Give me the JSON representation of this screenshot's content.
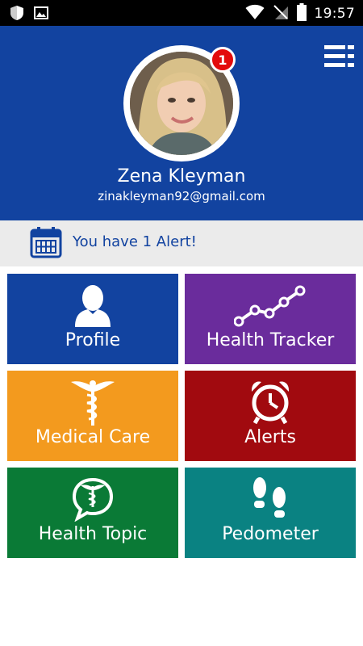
{
  "status_bar": {
    "time": "19:57",
    "icons": [
      "shield-icon",
      "image-icon",
      "wifi-icon",
      "no-sim-icon",
      "battery-icon"
    ]
  },
  "header": {
    "menu_icon": "menu-list-icon",
    "notification_count": "1",
    "user_name": "Zena Kleyman",
    "user_email": "zinakleyman92@gmail.com"
  },
  "alert": {
    "icon": "calendar-icon",
    "text": "You have 1 Alert!"
  },
  "tiles": [
    {
      "label": "Profile",
      "icon": "person-icon",
      "color": "#1243a0"
    },
    {
      "label": "Health Tracker",
      "icon": "line-chart-icon",
      "color": "#6a2c9c"
    },
    {
      "label": "Medical Care",
      "icon": "caduceus-icon",
      "color": "#f39a1e"
    },
    {
      "label": "Alerts",
      "icon": "alarm-clock-icon",
      "color": "#a10a0f"
    },
    {
      "label": "Health Topic",
      "icon": "chat-caduceus-icon",
      "color": "#0a7a36"
    },
    {
      "label": "Pedometer",
      "icon": "footprints-icon",
      "color": "#0a8282"
    }
  ],
  "colors": {
    "header_bg": "#1243a0",
    "alert_strip_bg": "#ebebeb",
    "badge": "#e30b0b"
  }
}
